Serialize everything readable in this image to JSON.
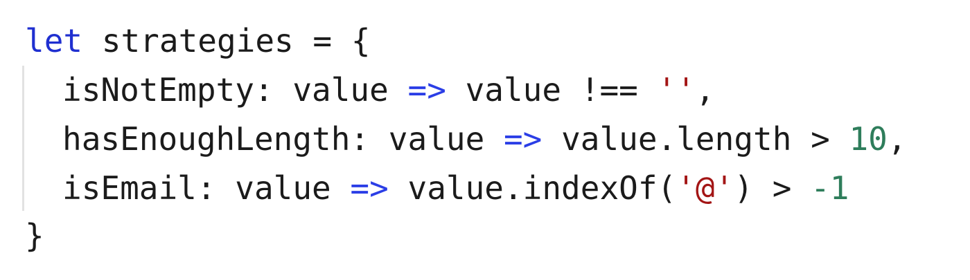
{
  "code": {
    "line1": {
      "keyword": "let",
      "rest": " strategies = {"
    },
    "line2": {
      "prefix": "isNotEmpty: value ",
      "arrow": "=>",
      "middle": " value !== ",
      "string": "''",
      "suffix": ","
    },
    "line3": {
      "prefix": "hasEnoughLength: value ",
      "arrow": "=>",
      "middle": " value.length > ",
      "number": "10",
      "suffix": ","
    },
    "line4": {
      "prefix": "isEmail: value ",
      "arrow": "=>",
      "middle": " value.indexOf(",
      "string": "'@'",
      "after": ") > ",
      "number": "-1"
    },
    "line5": {
      "text": "}"
    }
  },
  "colors": {
    "keyword": "#1f2fd0",
    "arrow": "#2b3ee6",
    "string": "#a31515",
    "number": "#2e7d5b",
    "text": "#1b1b1b",
    "background": "#ffffff"
  }
}
